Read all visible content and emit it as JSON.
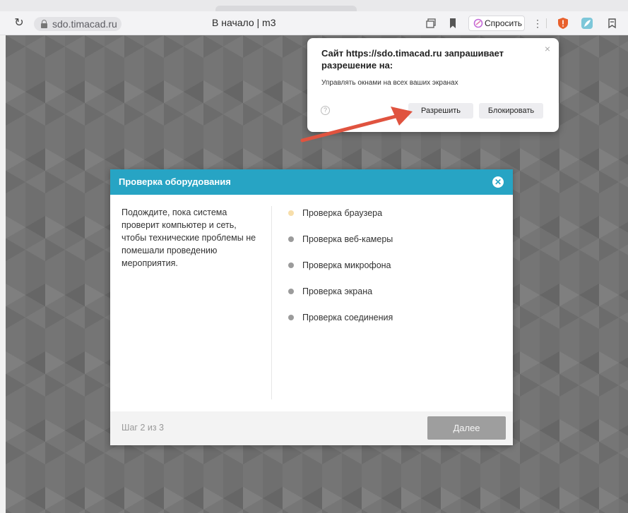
{
  "browser": {
    "url": "sdo.timacad.ru",
    "page_title": "В начало | m3",
    "ask_button": "Спросить",
    "menu_dots": "⋮"
  },
  "permission_popup": {
    "title": "Сайт https://sdo.timacad.ru запрашивает разрешение на:",
    "description": "Управлять окнами на всех ваших экранах",
    "help_glyph": "?",
    "close_glyph": "×",
    "allow_label": "Разрешить",
    "block_label": "Блокировать"
  },
  "modal": {
    "title": "Проверка оборудования",
    "close_glyph": "✕",
    "intro_text": "Подождите, пока система проверит компьютер и сеть, чтобы технические проблемы не помешали проведению мероприятия.",
    "checks": [
      {
        "label": "Проверка браузера",
        "state": "active"
      },
      {
        "label": "Проверка веб-камеры",
        "state": "pending"
      },
      {
        "label": "Проверка микрофона",
        "state": "pending"
      },
      {
        "label": "Проверка экрана",
        "state": "pending"
      },
      {
        "label": "Проверка соединения",
        "state": "pending"
      }
    ],
    "step_text": "Шаг 2 из 3",
    "next_label": "Далее"
  },
  "colors": {
    "modal_header": "#27a4c4",
    "active_dot": "#f7deaa",
    "pending_dot": "#9b9b9b",
    "arrow": "#e0533f"
  },
  "icons": [
    "reload-icon",
    "lock-icon",
    "tabs-icon",
    "bookmark-icon",
    "sparkle-icon",
    "shield-icon",
    "feather-icon",
    "profile-icon"
  ]
}
